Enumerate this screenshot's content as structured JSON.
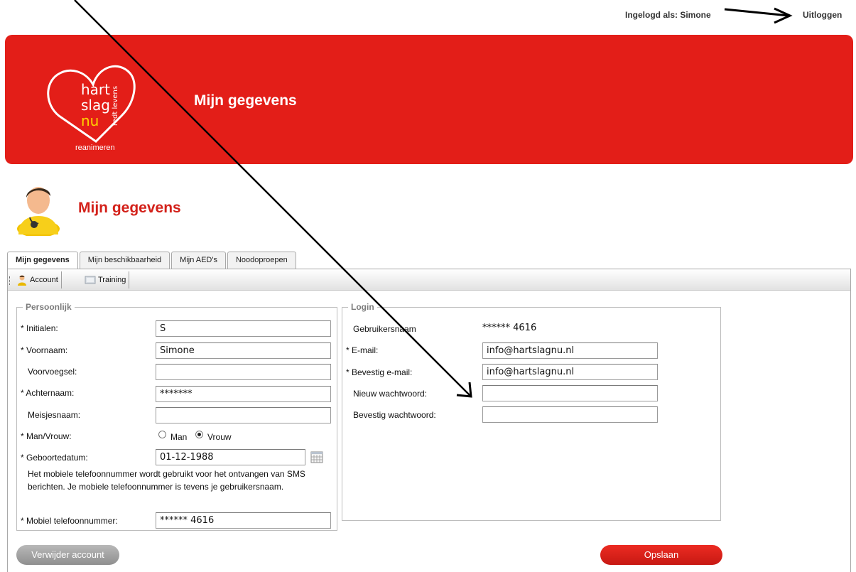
{
  "user_bar": {
    "logged_in_text": "Ingelogd als: Simone",
    "logout_label": "Uitloggen"
  },
  "header": {
    "title": "Mijn gegevens",
    "logo": {
      "line1": "hart",
      "line2": "slag",
      "line3": "nu",
      "side_text": "redt levens",
      "bottom_text": "reanimeren"
    }
  },
  "page": {
    "title": "Mijn gegevens"
  },
  "tabs": [
    {
      "label": "Mijn gegevens"
    },
    {
      "label": "Mijn beschikbaarheid"
    },
    {
      "label": "Mijn AED's"
    },
    {
      "label": "Noodoproepen"
    }
  ],
  "toolbar": {
    "account_label": "Account",
    "training_label": "Training"
  },
  "persoonlijk": {
    "legend": "Persoonlijk",
    "initialen_label": "* Initialen:",
    "initialen_value": "S",
    "voornaam_label": "* Voornaam:",
    "voornaam_value": "Simone",
    "voorvoegsel_label": "Voorvoegsel:",
    "voorvoegsel_value": "",
    "achternaam_label": "* Achternaam:",
    "achternaam_value": "*******",
    "meisjesnaam_label": "Meisjesnaam:",
    "meisjesnaam_value": "",
    "gender_label": "* Man/Vrouw:",
    "gender_option_man": "Man",
    "gender_option_vrouw": "Vrouw",
    "gender_selected": "Vrouw",
    "geboortedatum_label": "* Geboortedatum:",
    "geboortedatum_value": "01-12-1988",
    "mobile_note": "Het mobiele telefoonnummer wordt gebruikt voor het ontvangen van SMS berichten. Je mobiele telefoonnummer is tevens je gebruikersnaam.",
    "mobiel_label": "* Mobiel telefoonnummer:",
    "mobiel_value": "****** 4616"
  },
  "login": {
    "legend": "Login",
    "gebruikersnaam_label": "Gebruikersnaam",
    "gebruikersnaam_value": "****** 4616",
    "email_label": "* E-mail:",
    "email_value": "info@hartslagnu.nl",
    "bevestig_email_label": "* Bevestig e-mail:",
    "bevestig_email_value": "info@hartslagnu.nl",
    "nieuw_wachtwoord_label": "Nieuw wachtwoord:",
    "nieuw_wachtwoord_value": "",
    "bevestig_wachtwoord_label": "Bevestig wachtwoord:",
    "bevestig_wachtwoord_value": ""
  },
  "actions": {
    "delete_label": "Verwijder account",
    "save_label": "Opslaan"
  },
  "colors": {
    "brand_red": "#e31e18",
    "title_red": "#d3211a",
    "button_grey": "#9e9e9e"
  },
  "icons": [
    "user-avatar-icon",
    "account-icon",
    "training-icon",
    "calendar-icon",
    "annotation-arrow-icon"
  ]
}
